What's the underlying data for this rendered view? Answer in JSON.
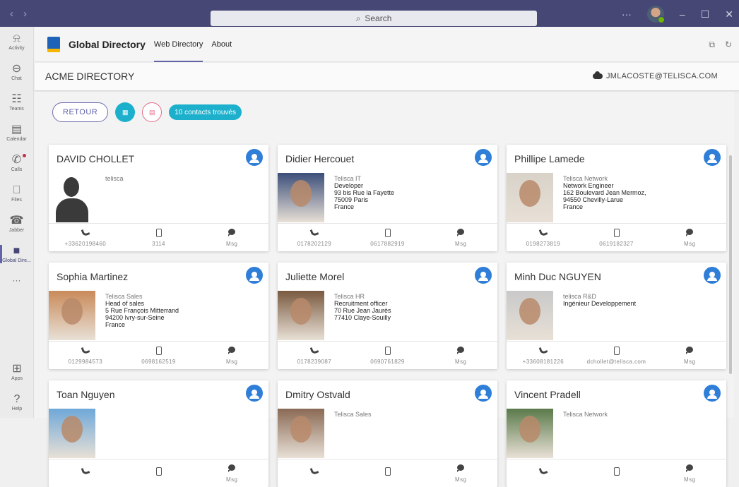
{
  "search": {
    "placeholder": "Search"
  },
  "rail": [
    {
      "label": "Activity",
      "icon": "bell-icon",
      "glyph": "⍾"
    },
    {
      "label": "Chat",
      "icon": "chat-icon",
      "glyph": "⊖"
    },
    {
      "label": "Teams",
      "icon": "teams-icon",
      "glyph": "☷"
    },
    {
      "label": "Calendar",
      "icon": "calendar-icon",
      "glyph": "▤"
    },
    {
      "label": "Calls",
      "icon": "phone-icon",
      "glyph": "✆"
    },
    {
      "label": "Files",
      "icon": "file-icon",
      "glyph": "⎕"
    },
    {
      "label": "Jabber",
      "icon": "jabber-icon",
      "glyph": "☎"
    },
    {
      "label": "Global Dire...",
      "icon": "global-directory-icon",
      "glyph": "■"
    }
  ],
  "rail_more": "···",
  "rail_bottom": [
    {
      "label": "Apps",
      "icon": "apps-icon",
      "glyph": "⊞"
    },
    {
      "label": "Help",
      "icon": "help-icon",
      "glyph": "?"
    }
  ],
  "app": {
    "title": "Global Directory",
    "tabs": [
      "Web Directory",
      "About"
    ]
  },
  "header": {
    "title": "ACME DIRECTORY",
    "user": "JMLACOSTE@TELISCA.COM"
  },
  "toolbar": {
    "back": "RETOUR",
    "count": "10 contacts trouvés"
  },
  "footer_msg_label": "Msg",
  "contacts": [
    {
      "name": "DAVID CHOLLET",
      "lines": [
        "telisca"
      ],
      "phone": "+33620198460",
      "mobile": "3114",
      "photo": "silhouette"
    },
    {
      "name": "Didier Hercouet",
      "lines": [
        "Telisca IT",
        "Developer",
        "93 bis Rue la Fayette",
        "75009 Paris",
        "France"
      ],
      "phone": "0178202129",
      "mobile": "0617882919",
      "photo": "#3c4f7a"
    },
    {
      "name": "Phillipe Lamede",
      "lines": [
        "Telisca Network",
        "Network Engineer",
        "162 Boulevard Jean Mermoz,",
        "94550 Chevilly-Larue",
        "France"
      ],
      "phone": "0198273819",
      "mobile": "0619182327",
      "photo": "#d8d2c8"
    },
    {
      "name": "Sophia Martinez",
      "lines": [
        "Telisca Sales",
        "Head of sales",
        "5 Rue François Mitterrand",
        "94200 Ivry-sur-Seine",
        "France"
      ],
      "phone": "0129984573",
      "mobile": "0698162519",
      "photo": "#c98a5a"
    },
    {
      "name": "Juliette Morel",
      "lines": [
        "Telisca HR",
        "Recruitment officer",
        "70 Rue Jean Jaurès",
        "77410 Claye-Souilly"
      ],
      "phone": "0178239087",
      "mobile": "0690761829",
      "photo": "#7a5a40"
    },
    {
      "name": "Minh Duc NGUYEN",
      "lines": [
        "telisca R&D",
        "Ingénieur Developpement"
      ],
      "phone": "+33608181226",
      "mobile": "dchollet@telisca.com",
      "photo": "#c9c9c9"
    },
    {
      "name": "Toan Nguyen",
      "lines": [],
      "phone": "",
      "mobile": "",
      "photo": "#6fa8d8"
    },
    {
      "name": "Dmitry Ostvald",
      "lines": [
        "Telisca Sales"
      ],
      "phone": "",
      "mobile": "",
      "photo": "#8a6a55"
    },
    {
      "name": "Vincent Pradell",
      "lines": [
        "Telisca Network"
      ],
      "phone": "",
      "mobile": "",
      "photo": "#5b7a4a"
    }
  ]
}
